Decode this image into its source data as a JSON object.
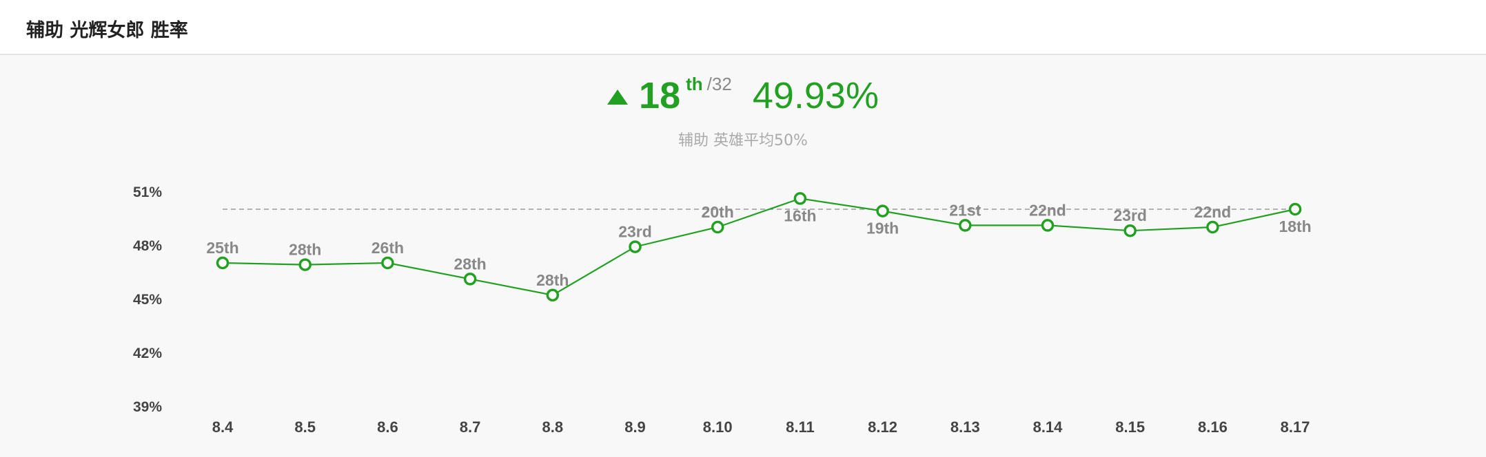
{
  "header": {
    "title": "辅助 光辉女郎 胜率"
  },
  "summary": {
    "rank": "18",
    "rank_suffix": "th",
    "rank_total": "/32",
    "win_rate": "49.93%",
    "trend": "up",
    "subtitle": "辅助 英雄平均50%"
  },
  "colors": {
    "accent": "#22a022",
    "reference_line": "#999999",
    "axis_text": "#444444",
    "label_text": "#888888"
  },
  "chart_data": {
    "type": "line",
    "title": "",
    "xlabel": "",
    "ylabel": "",
    "categories": [
      "8.4",
      "8.5",
      "8.6",
      "8.7",
      "8.8",
      "8.9",
      "8.10",
      "8.11",
      "8.12",
      "8.13",
      "8.14",
      "8.15",
      "8.16",
      "8.17"
    ],
    "series": [
      {
        "values": [
          47.0,
          46.9,
          47.0,
          46.1,
          45.2,
          47.9,
          49.0,
          50.6,
          49.9,
          49.1,
          49.1,
          48.8,
          49.0,
          50.0
        ],
        "rank_labels": [
          "25th",
          "28th",
          "26th",
          "28th",
          "28th",
          "23rd",
          "20th",
          "16th",
          "19th",
          "21st",
          "22nd",
          "23rd",
          "22nd",
          "18th"
        ],
        "label_position": [
          "above",
          "above",
          "above",
          "above",
          "above",
          "above",
          "above",
          "below",
          "below",
          "above",
          "above",
          "above",
          "above",
          "below"
        ]
      }
    ],
    "reference_line": {
      "value": 50
    },
    "y_ticks": [
      "51%",
      "48%",
      "45%",
      "42%",
      "39%"
    ],
    "y_tick_values": [
      51,
      48,
      45,
      42,
      39
    ],
    "ylim": [
      39,
      51
    ],
    "grid": false,
    "legend": "none"
  }
}
